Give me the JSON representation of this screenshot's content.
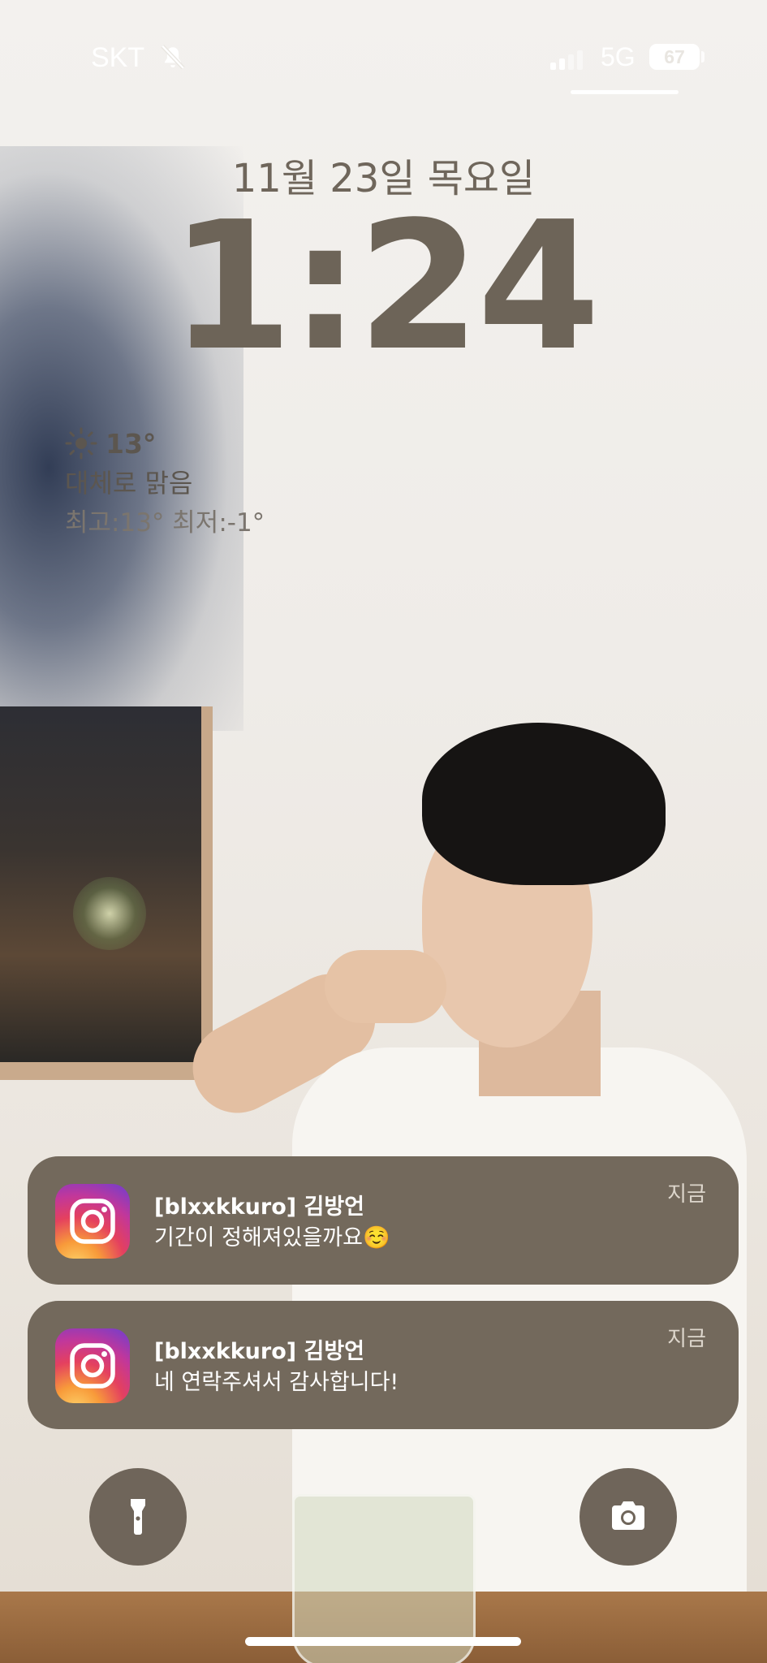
{
  "status_bar": {
    "carrier": "SKT",
    "network": "5G",
    "battery": "67",
    "silent_icon": "bell-slash-icon",
    "signal_icon": "cellular-signal-icon"
  },
  "lock_screen": {
    "date": "11월 23일 목요일",
    "time": "1:24"
  },
  "weather": {
    "icon": "sun-icon",
    "temperature": "13°",
    "condition": "대체로 맑음",
    "high_low": "최고:13° 최저:-1°"
  },
  "notifications": [
    {
      "app_icon": "instagram-icon",
      "title": "[blxxkkuro] 김방언",
      "message": "기간이 정해져있을까요☺️",
      "time": "지금"
    },
    {
      "app_icon": "instagram-icon",
      "title": "[blxxkkuro] 김방언",
      "message": "네 연락주셔서 감사합니다!",
      "time": "지금"
    }
  ],
  "quick_actions": {
    "left_icon": "flashlight-icon",
    "right_icon": "camera-icon"
  },
  "colors": {
    "notification_bg": "#73695c",
    "clock_text": "#6d6458",
    "button_bg": "#6f655a"
  }
}
